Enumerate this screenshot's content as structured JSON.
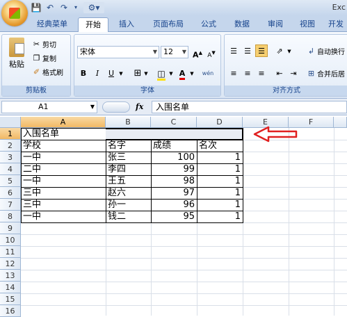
{
  "title_bar": {
    "app_title": "Exc"
  },
  "quick_access": {
    "save_icon": "save-icon",
    "undo_icon": "undo-icon",
    "redo_icon": "redo-icon",
    "customize_icon": "customize-icon"
  },
  "tabs": [
    {
      "label": "经典菜单"
    },
    {
      "label": "开始"
    },
    {
      "label": "插入"
    },
    {
      "label": "页面布局"
    },
    {
      "label": "公式"
    },
    {
      "label": "数据"
    },
    {
      "label": "审阅"
    },
    {
      "label": "视图"
    },
    {
      "label": "开发"
    }
  ],
  "ribbon": {
    "clipboard": {
      "group_label": "剪贴板",
      "paste": "粘贴",
      "cut": "剪切",
      "copy": "复制",
      "format_painter": "格式刷"
    },
    "font": {
      "group_label": "字体",
      "font_name": "宋体",
      "font_size": "12",
      "grow": "A",
      "shrink": "A",
      "bold": "B",
      "italic": "I",
      "underline": "U",
      "font_color_letter": "A",
      "phonetic": "wén"
    },
    "alignment": {
      "group_label": "对齐方式",
      "wrap_text": "自动换行",
      "merge_center": "合并后居"
    }
  },
  "formula_bar": {
    "name_box": "A1",
    "fx": "fx",
    "content": "入围名单"
  },
  "sheet": {
    "columns": [
      "A",
      "B",
      "C",
      "D",
      "E",
      "F"
    ],
    "rows": [
      "1",
      "2",
      "3",
      "4",
      "5",
      "6",
      "7",
      "8",
      "9",
      "10",
      "11",
      "12",
      "13",
      "14",
      "15",
      "16"
    ],
    "selected_column": "A",
    "selected_row": "1",
    "cells": {
      "r1": {
        "a": "入围名单"
      },
      "header": {
        "a": "学校",
        "b": "名字",
        "c": "成绩",
        "d": "名次"
      },
      "data": [
        {
          "school": "一中",
          "name": "张三",
          "score": "100",
          "rank": "1"
        },
        {
          "school": "二中",
          "name": "李四",
          "score": "99",
          "rank": "1"
        },
        {
          "school": "一中",
          "name": "王五",
          "score": "98",
          "rank": "1"
        },
        {
          "school": "三中",
          "name": "赵六",
          "score": "97",
          "rank": "1"
        },
        {
          "school": "三中",
          "name": "孙一",
          "score": "96",
          "rank": "1"
        },
        {
          "school": "一中",
          "name": "钱二",
          "score": "95",
          "rank": "1"
        }
      ]
    }
  },
  "annotation": {
    "arrow_color": "#e02020"
  },
  "colors": {
    "ribbon_blue": "#c5d6ec",
    "selection_orange": "#f1b965"
  }
}
